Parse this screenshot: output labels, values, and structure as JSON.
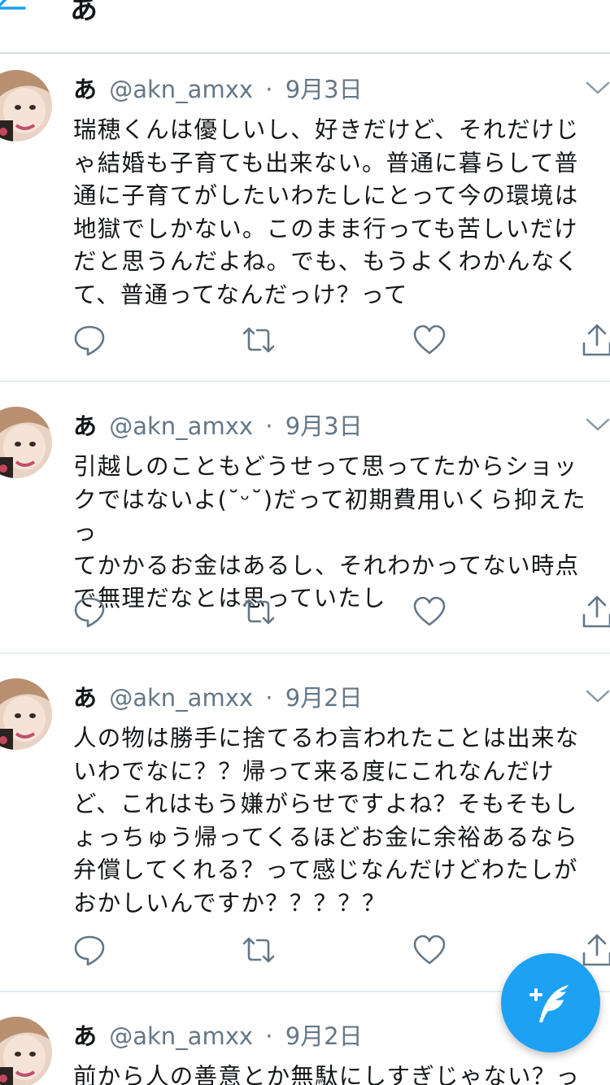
{
  "header": {
    "back_icon": "arrow-left-icon",
    "title": "あ"
  },
  "colors": {
    "accent": "#1da1f2",
    "text": "#14171a",
    "secondary": "#657786",
    "divider": "#e6ecf0"
  },
  "tweets": [
    {
      "name": "あ",
      "handle": "@akn_amxx",
      "separator": "·",
      "date": "9月3日",
      "text": "瑞穂くんは優しいし、好きだけど、それだけじ\nゃ結婚も子育ても出来ない。普通に暮らして普\n通に子育てがしたいわたしにとって今の環境は\n地獄でしかない。このまま行っても苦しいだけ\nだと思うんだよね。でも、もうよくわかんなく\nて、普通ってなんだっけ？って"
    },
    {
      "name": "あ",
      "handle": "@akn_amxx",
      "separator": "·",
      "date": "9月3日",
      "text": "引越しのこともどうせって思ってたからショッ\nクではないよ(˘ᵕ˘)だって初期費用いくら抑えたっ\nてかかるお金はあるし、それわかってない時点\nで無理だなとは思っていたし"
    },
    {
      "name": "あ",
      "handle": "@akn_amxx",
      "separator": "·",
      "date": "9月2日",
      "text": "人の物は勝手に捨てるわ言われたことは出来な\nいわでなに？？帰って来る度にこれなんだけ\nど、これはもう嫌がらせですよね？そもそもし\nょっちゅう帰ってくるほどお金に余裕あるなら\n弁償してくれる？って感じなんだけどわたしが\nおかしいんですか？？？？？"
    },
    {
      "name": "あ",
      "handle": "@akn_amxx",
      "separator": "·",
      "date": "9月2日",
      "text": "前から人の善意とか無駄にしすぎじゃない？っ"
    }
  ],
  "action_icons": [
    "reply-icon",
    "retweet-icon",
    "like-icon",
    "share-icon"
  ],
  "fab": {
    "icon": "compose-tweet-icon"
  }
}
